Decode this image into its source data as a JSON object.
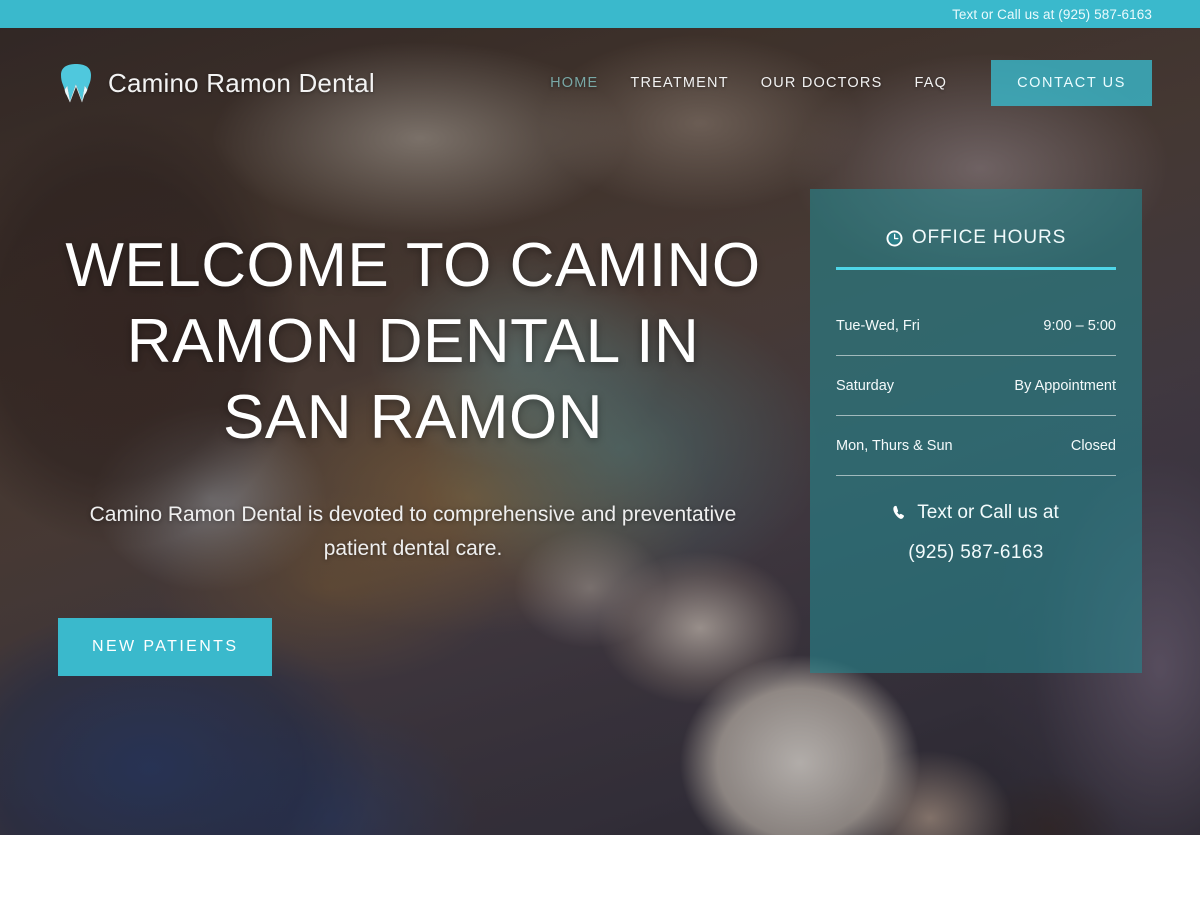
{
  "topbar": {
    "contact_text": "Text or Call us at (925) 587-6163"
  },
  "header": {
    "logo_icon": "tooth-icon",
    "brand_name": "Camino Ramon Dental",
    "nav": [
      {
        "label": "HOME",
        "active": true
      },
      {
        "label": "TREATMENT",
        "active": false
      },
      {
        "label": "OUR DOCTORS",
        "active": false
      },
      {
        "label": "FAQ",
        "active": false
      }
    ],
    "cta_label": "CONTACT US"
  },
  "hero": {
    "title": "WELCOME TO CAMINO RAMON DENTAL IN SAN RAMON",
    "subtitle": "Camino Ramon Dental is devoted to comprehensive and preventative patient dental care.",
    "cta_label": "NEW PATIENTS"
  },
  "office_hours": {
    "icon": "clock-icon",
    "title": "OFFICE HOURS",
    "rows": [
      {
        "days": "Tue-Wed, Fri",
        "value": "9:00 – 5:00"
      },
      {
        "days": "Saturday",
        "value": "By Appointment"
      },
      {
        "days": "Mon, Thurs & Sun",
        "value": "Closed"
      }
    ],
    "phone_icon": "phone-icon",
    "phone_label": "Text or Call us at",
    "phone_number": "(925) 587-6163"
  },
  "colors": {
    "accent_teal": "#3ab9cc",
    "panel_teal": "#26848d",
    "rule_teal": "#4fd6e8",
    "nav_active": "#79a8a6",
    "text_light": "#f2f2f2"
  }
}
